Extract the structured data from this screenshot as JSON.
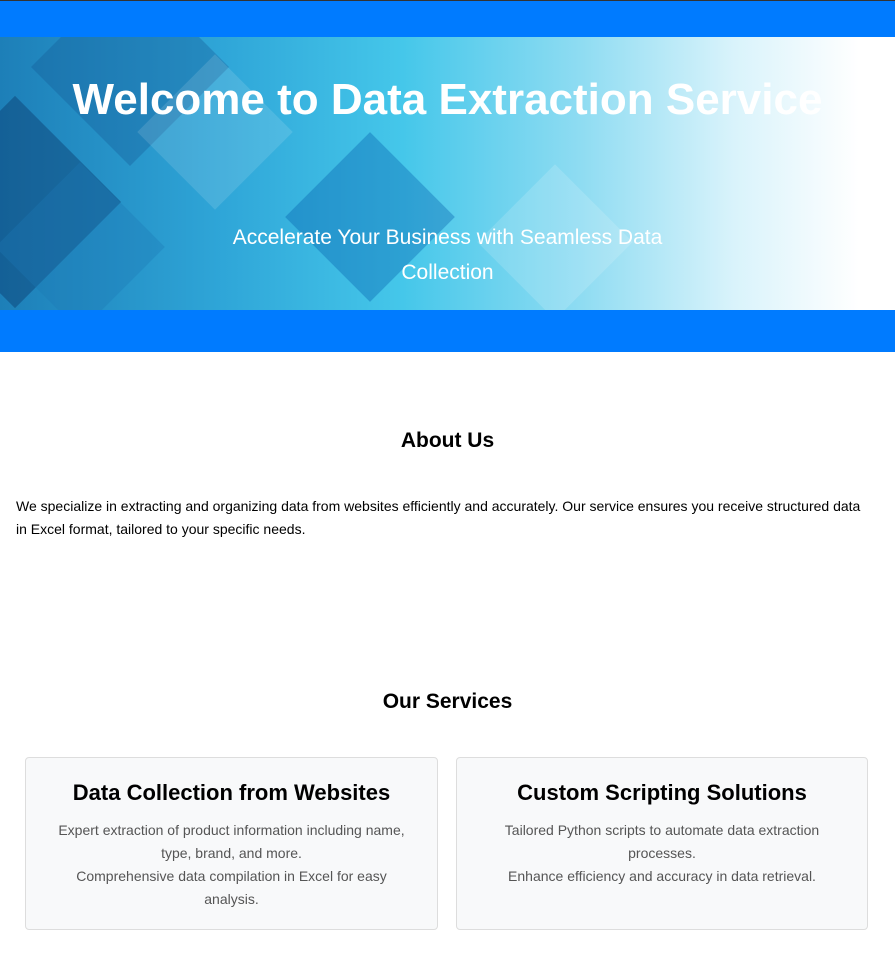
{
  "hero": {
    "title": "Welcome to Data Extraction Service",
    "subtitle": "Accelerate Your Business with Seamless Data Collection"
  },
  "about": {
    "title": "About Us",
    "text": "We specialize in extracting and organizing data from websites efficiently and accurately. Our service ensures you receive structured data in Excel format, tailored to your specific needs."
  },
  "services": {
    "title": "Our Services",
    "cards": [
      {
        "title": "Data Collection from Websites",
        "line1": "Expert extraction of product information including name, type, brand, and more.",
        "line2": "Comprehensive data compilation in Excel for easy analysis."
      },
      {
        "title": "Custom Scripting Solutions",
        "line1": "Tailored Python scripts to automate data extraction processes.",
        "line2": "Enhance efficiency and accuracy in data retrieval."
      }
    ]
  },
  "colors": {
    "accent": "#007bff",
    "card_bg": "#f8f9fa"
  }
}
